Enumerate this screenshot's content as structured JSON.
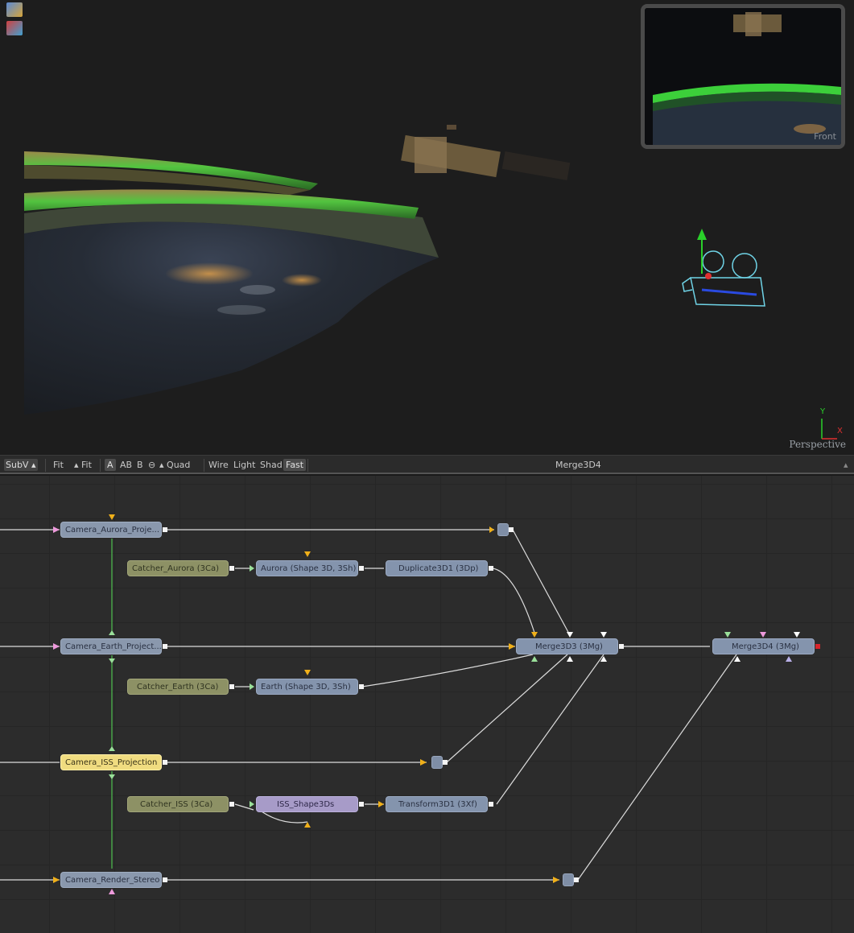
{
  "viewer": {
    "corner_label": "Perspective",
    "mini_view_label": "Front",
    "axis": {
      "y": "Y",
      "x": "X"
    },
    "tool_icons": [
      "viewer-3d-cube-icon",
      "viewer-3d-cube-colored-icon"
    ]
  },
  "toolbar": {
    "subv": "SubV",
    "fit1": "Fit",
    "fit2": "Fit",
    "a": "A",
    "ab": "AB",
    "b": "B",
    "quad": "Quad",
    "wire": "Wire",
    "light": "Light",
    "shad": "Shad",
    "fast": "Fast",
    "title": "Merge3D4"
  },
  "nodes": {
    "camera_aurora": "Camera_Aurora_Proje...",
    "catcher_aurora": "Catcher_Aurora  (3Ca)",
    "aurora": "Aurora  (Shape 3D, 3Sh)",
    "duplicate": "Duplicate3D1  (3Dp)",
    "camera_earth": "Camera_Earth_Project...",
    "catcher_earth": "Catcher_Earth  (3Ca)",
    "earth": "Earth  (Shape 3D, 3Sh)",
    "merge3d3": "Merge3D3  (3Mg)",
    "merge3d4": "Merge3D4  (3Mg)",
    "camera_iss": "Camera_ISS_Projection",
    "catcher_iss": "Catcher_ISS  (3Ca)",
    "iss_shape": "ISS_Shape3Ds",
    "transform": "Transform3D1  (3Xf)",
    "camera_render": "Camera_Render_Stereo"
  },
  "colors": {
    "camera_node": "#8a98ad",
    "catcher_node": "#8d9165",
    "selected_node": "#f0dc80",
    "group_node": "#a79bc8",
    "aurora_green": "#3ccf3a",
    "camera_gizmo": "#6fd3e6"
  }
}
